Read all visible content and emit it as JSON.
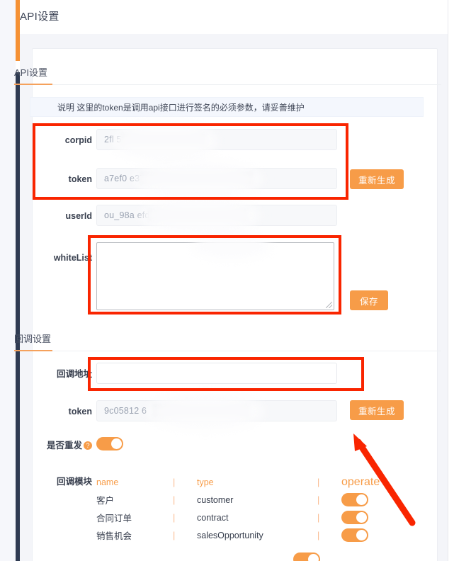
{
  "page": {
    "title": "API设置"
  },
  "sections": {
    "api": {
      "label": "API设置"
    },
    "callback": {
      "label": "回调设置"
    }
  },
  "notice": {
    "text": "说明 这里的token是调用api接口进行签名的必须参数，请妥善维护"
  },
  "api_form": {
    "corpid": {
      "label": "corpid",
      "value": "2fl                      5f",
      "redacted": true
    },
    "token": {
      "label": "token",
      "value": "a7ef0                                        e37b9",
      "redacted": true
    },
    "userId": {
      "label": "userId",
      "value": "ou_98a                                 efdfd5da7",
      "redacted": true
    },
    "whiteList": {
      "label": "whiteList",
      "value": "",
      "placeholder": ""
    },
    "regenerate_label": "重新生成",
    "save_label": "保存"
  },
  "callback_form": {
    "url": {
      "label": "回调地址",
      "value": "",
      "placeholder": ""
    },
    "token": {
      "label": "token",
      "value": "9c05812                                   6",
      "redacted": true
    },
    "regenerate_label": "重新生成",
    "resend": {
      "label": "是否重发",
      "help": "?",
      "enabled": true
    },
    "modules_label": "回调模块",
    "columns": {
      "name": "name",
      "sep": "|",
      "type": "type",
      "operate": "operate"
    },
    "modules": [
      {
        "name": "客户",
        "type": "customer",
        "enabled": true
      },
      {
        "name": "合同订单",
        "type": "contract",
        "enabled": true
      },
      {
        "name": "销售机会",
        "type": "salesOpportunity",
        "enabled": true
      }
    ]
  },
  "colors": {
    "accent": "#f79c48",
    "rail_accent": "#f59134",
    "rail": "#2f3b52",
    "annotation": "#f92500",
    "notice_bg": "#f4f7fd"
  }
}
